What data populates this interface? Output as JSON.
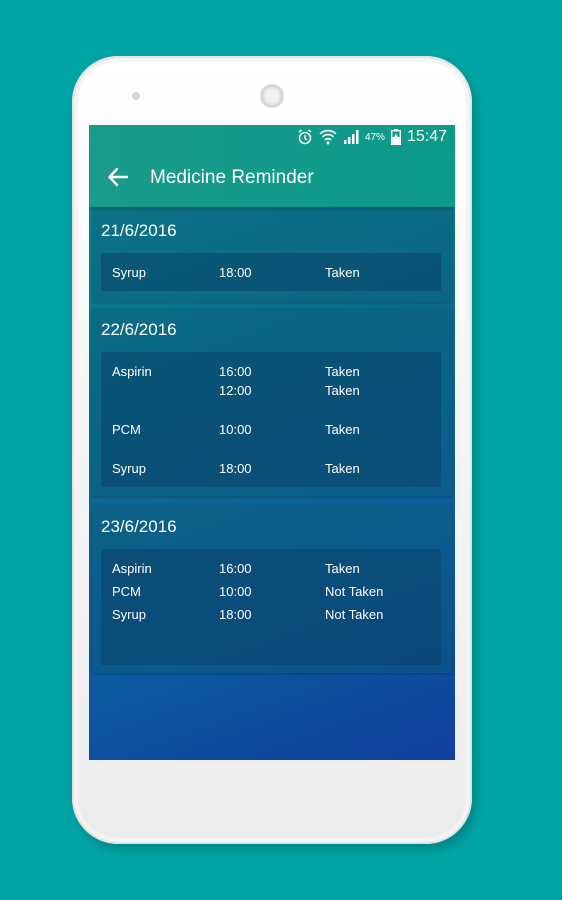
{
  "status_bar": {
    "battery": "47%",
    "time": "15:47"
  },
  "app_bar": {
    "title": "Medicine Reminder"
  },
  "days": [
    {
      "date": "21/6/2016",
      "entries": [
        {
          "name": "Syrup",
          "times": [
            "18:00"
          ],
          "statuses": [
            "Taken"
          ]
        }
      ]
    },
    {
      "date": "22/6/2016",
      "entries": [
        {
          "name": "Aspirin",
          "times": [
            "16:00",
            "12:00"
          ],
          "statuses": [
            "Taken",
            "Taken"
          ]
        },
        {
          "name": "PCM",
          "times": [
            "10:00"
          ],
          "statuses": [
            "Taken"
          ]
        },
        {
          "name": "Syrup",
          "times": [
            "18:00"
          ],
          "statuses": [
            "Taken"
          ]
        }
      ]
    },
    {
      "date": "23/6/2016",
      "entries": [
        {
          "name": "Aspirin",
          "times": [
            "16:00"
          ],
          "statuses": [
            "Taken"
          ]
        },
        {
          "name": "PCM",
          "times": [
            "10:00"
          ],
          "statuses": [
            "Not Taken"
          ]
        },
        {
          "name": "Syrup",
          "times": [
            "18:00"
          ],
          "statuses": [
            "Not Taken"
          ]
        }
      ]
    }
  ]
}
